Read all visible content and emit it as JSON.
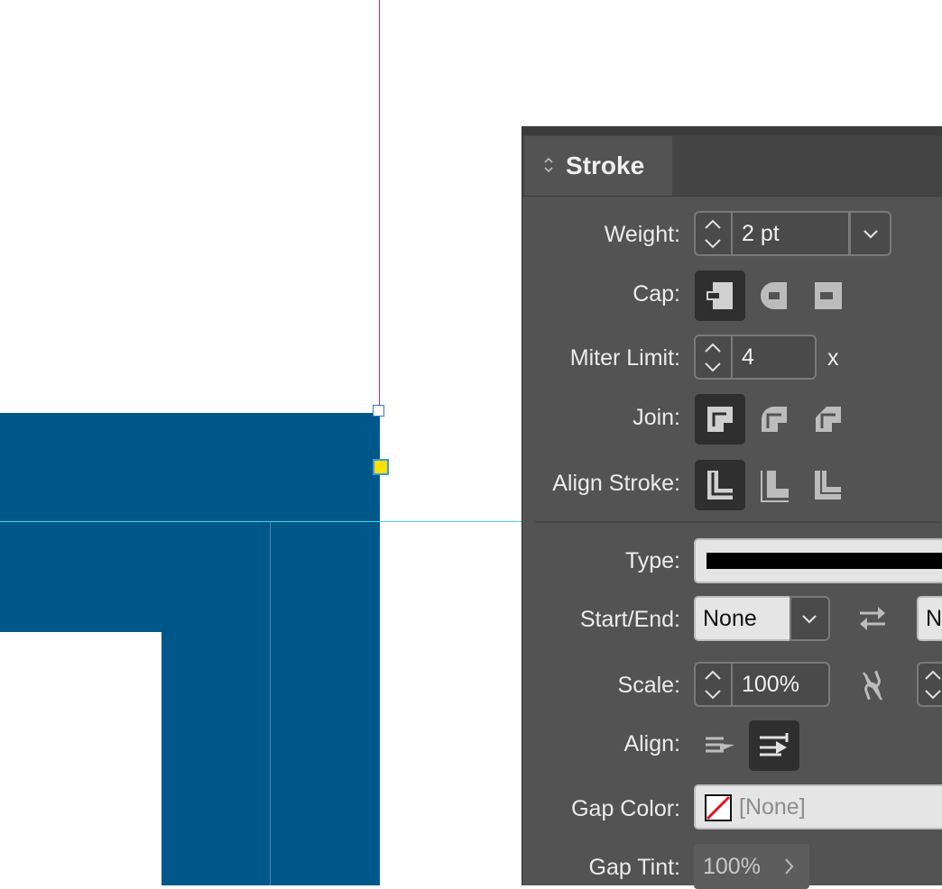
{
  "colors": {
    "shape_fill": "#00588a",
    "panel_bg": "#535353",
    "purple_guide": "#8a2be2",
    "cyan_guide": "#3fd6e6",
    "handle_yellow": "#ffe000"
  },
  "panel": {
    "tab_label": "Stroke",
    "tab_icon": "chevron-updown-icon",
    "weight": {
      "label": "Weight:",
      "value": "2 pt"
    },
    "cap": {
      "label": "Cap:",
      "options": [
        "butt-cap-icon",
        "round-cap-icon",
        "projecting-cap-icon"
      ],
      "selected": 0
    },
    "miter": {
      "label": "Miter Limit:",
      "value": "4",
      "suffix": "x"
    },
    "join": {
      "label": "Join:",
      "options": [
        "miter-join-icon",
        "round-join-icon",
        "bevel-join-icon"
      ],
      "selected": 0
    },
    "align_stroke": {
      "label": "Align Stroke:",
      "options": [
        "align-center-icon",
        "align-inside-icon",
        "align-outside-icon"
      ],
      "selected": 0
    },
    "type": {
      "label": "Type:"
    },
    "start_end": {
      "label": "Start/End:",
      "start_value": "None",
      "end_value_partial": "N"
    },
    "scale": {
      "label": "Scale:",
      "value": "100%"
    },
    "align": {
      "label": "Align:",
      "options": [
        "extend-arrow-tip-icon",
        "place-arrow-tip-icon"
      ],
      "selected": 1
    },
    "gap_color": {
      "label": "Gap Color:",
      "value": "[None]"
    },
    "gap_tint": {
      "label": "Gap Tint:",
      "value": "100%"
    }
  }
}
